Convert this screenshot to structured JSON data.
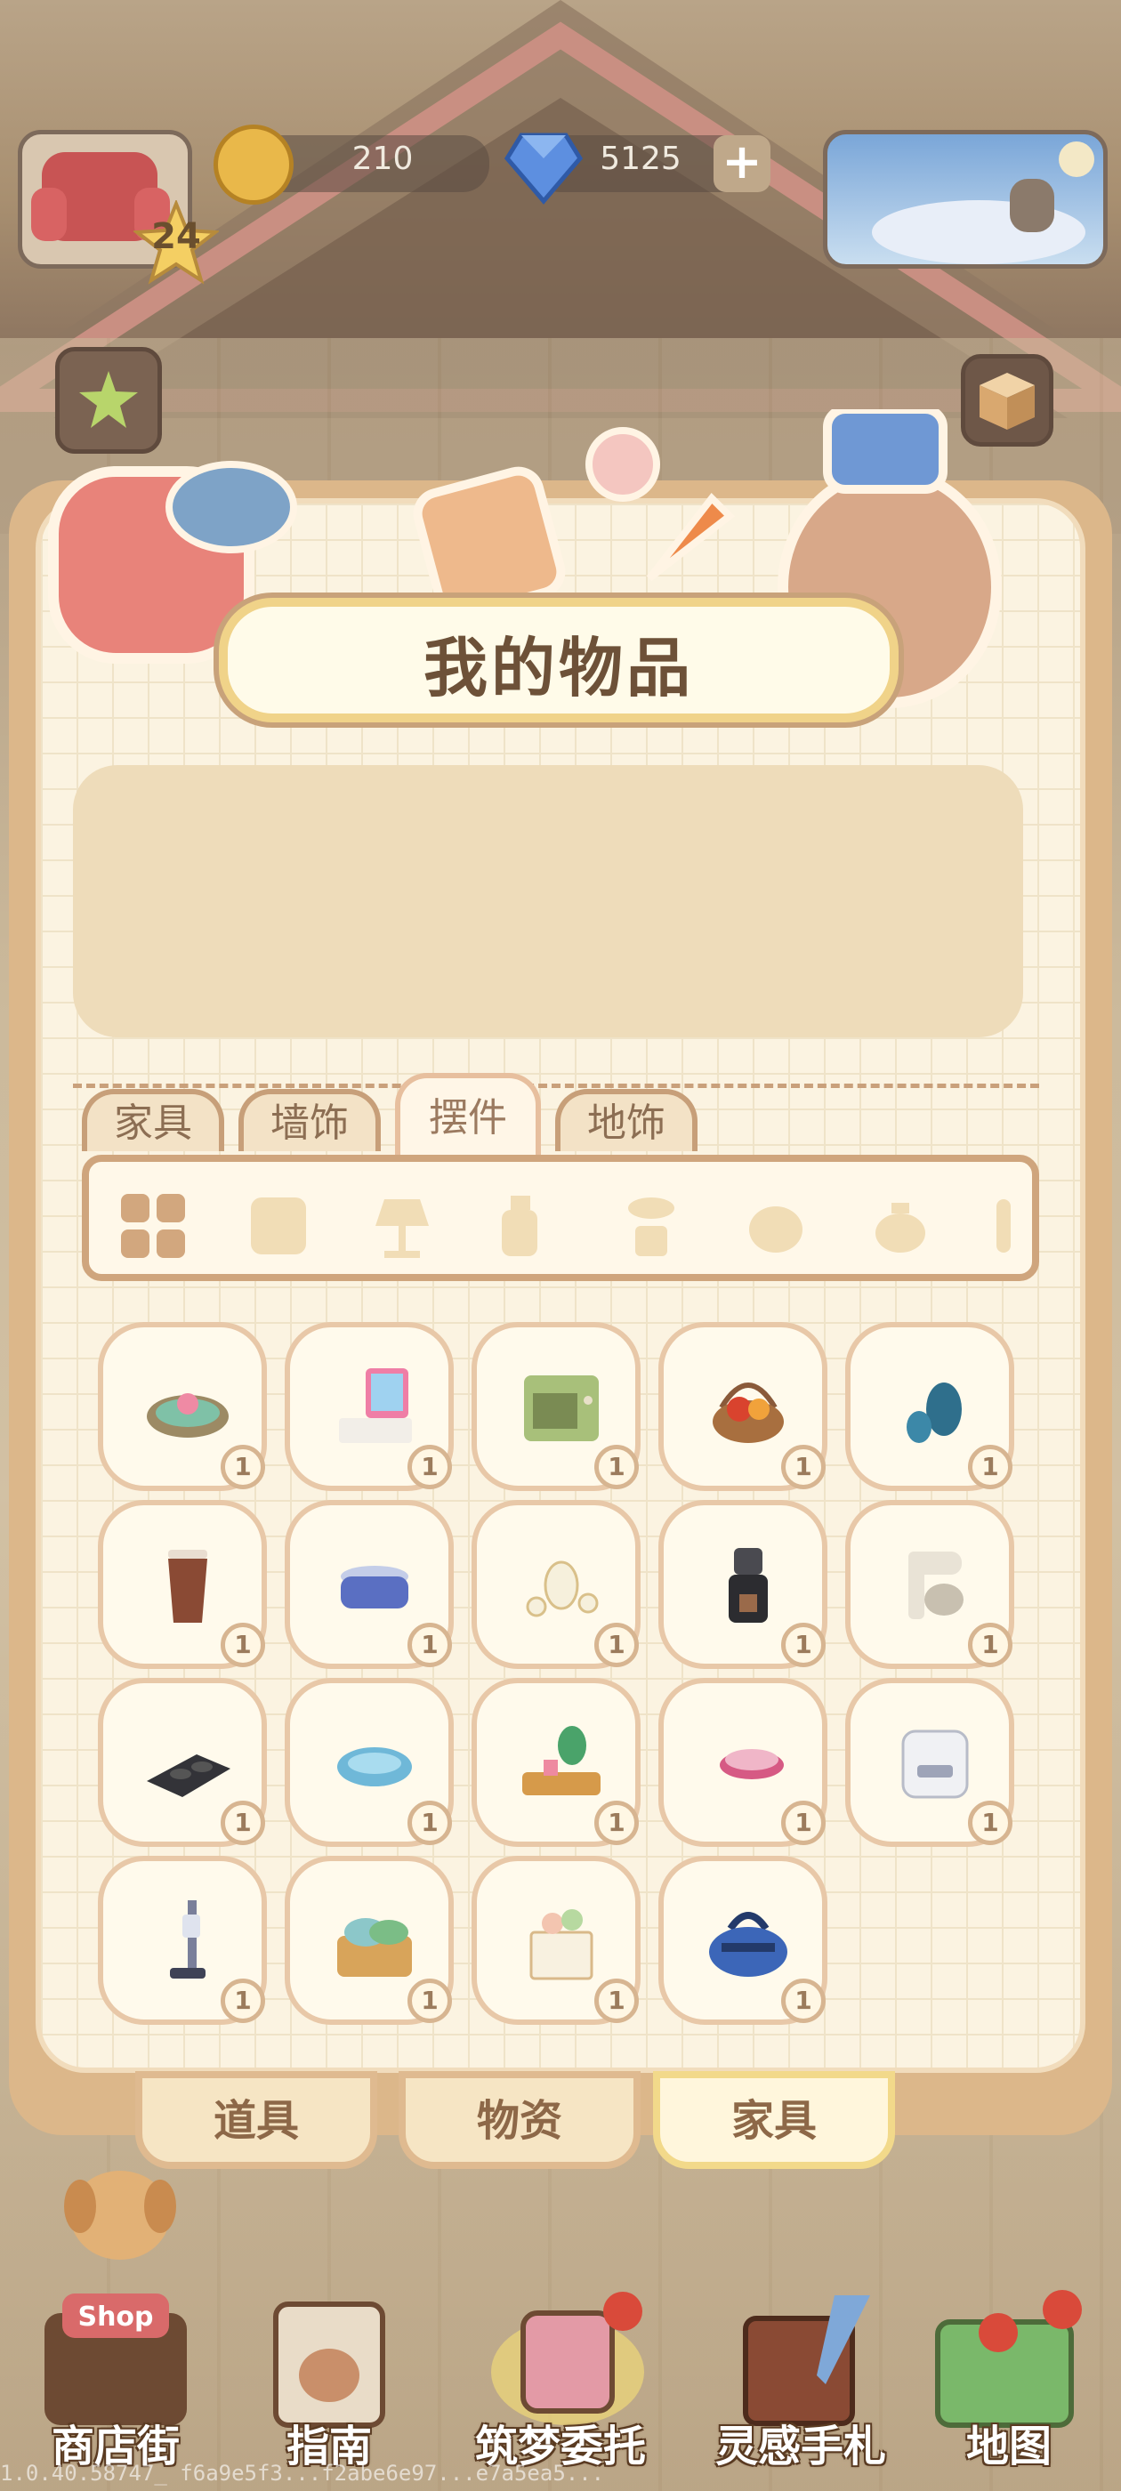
{
  "hud": {
    "level": "24",
    "coins": "210",
    "gems": "5125",
    "plus_label": "+"
  },
  "panel": {
    "title": "我的物品"
  },
  "tabs": [
    {
      "label": "家具",
      "active": false
    },
    {
      "label": "墙饰",
      "active": false
    },
    {
      "label": "摆件",
      "active": true
    },
    {
      "label": "地饰",
      "active": false
    }
  ],
  "categories": [
    "all-grid-icon",
    "scroll-icon",
    "lamp-icon",
    "bottle-icon",
    "plant-icon",
    "animal-head-icon",
    "teapot-icon",
    "cactus-icon"
  ],
  "items": [
    {
      "name": "lotus-dish",
      "count": "1"
    },
    {
      "name": "cash-register",
      "count": "1"
    },
    {
      "name": "green-oven",
      "count": "1"
    },
    {
      "name": "fruit-basket",
      "count": "1"
    },
    {
      "name": "blue-vases",
      "count": "1"
    },
    {
      "name": "coffee-cup",
      "count": "1"
    },
    {
      "name": "blue-pot",
      "count": "1"
    },
    {
      "name": "tea-set",
      "count": "1"
    },
    {
      "name": "coffee-grinder",
      "count": "1"
    },
    {
      "name": "stand-mixer",
      "count": "1"
    },
    {
      "name": "induction-cooktop",
      "count": "1"
    },
    {
      "name": "pet-bowl",
      "count": "1"
    },
    {
      "name": "plant-tray",
      "count": "1"
    },
    {
      "name": "plate-stack",
      "count": "1"
    },
    {
      "name": "rice-cooker",
      "count": "1"
    },
    {
      "name": "stick-vacuum",
      "count": "1"
    },
    {
      "name": "laundry-basket",
      "count": "1"
    },
    {
      "name": "gift-bag",
      "count": "1"
    },
    {
      "name": "duffel-bag",
      "count": "1"
    }
  ],
  "partial_counts": [
    "1",
    "1",
    "1",
    "1",
    "1"
  ],
  "bottom_tabs": [
    {
      "label": "道具",
      "active": false
    },
    {
      "label": "物资",
      "active": false
    },
    {
      "label": "家具",
      "active": true
    }
  ],
  "nav": [
    {
      "label": "商店街",
      "icon": "shop-icon",
      "sign": "Shop"
    },
    {
      "label": "指南",
      "icon": "guide-book-icon"
    },
    {
      "label": "筑梦委托",
      "icon": "notebook-icon"
    },
    {
      "label": "灵感手札",
      "icon": "journal-quill-icon"
    },
    {
      "label": "地图",
      "icon": "map-icon"
    }
  ],
  "version": "1.0.40.58747_ f6a9e5f3...f2abe6e97...e7a5ea5...",
  "colors": {
    "panel_border": "#dcb78a",
    "panel_bg": "#fbf3e1",
    "tab_border": "#c79f79",
    "title_text": "#6d5138"
  }
}
